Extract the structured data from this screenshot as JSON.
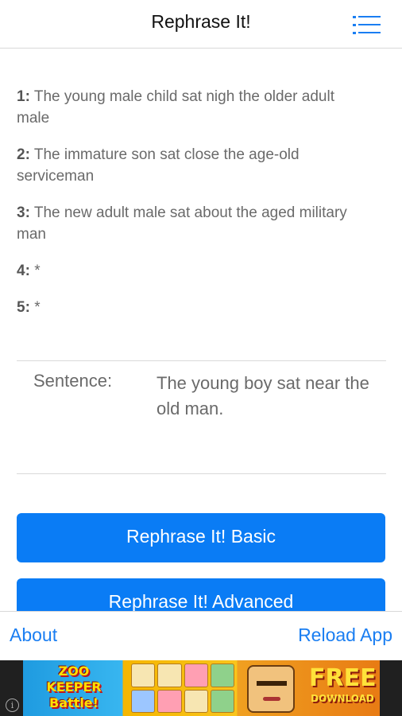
{
  "header": {
    "title": "Rephrase It!",
    "menu_icon": "list-menu-icon"
  },
  "results": [
    {
      "num": "1:",
      "text": "The young male child sat nigh the older adult male"
    },
    {
      "num": "2:",
      "text": "The immature son sat close the age-old serviceman"
    },
    {
      "num": "3:",
      "text": "The new adult male sat about the aged military man"
    },
    {
      "num": "4:",
      "text": "*"
    },
    {
      "num": "5:",
      "text": "*"
    }
  ],
  "sentence": {
    "label": "Sentence:",
    "value": "The young boy sat near the old man."
  },
  "buttons": {
    "basic": "Rephrase It! Basic",
    "advanced": "Rephrase It! Advanced"
  },
  "footer": {
    "about": "About",
    "reload": "Reload App"
  },
  "ad": {
    "info_icon": "info-icon",
    "title_line1": "ZOO",
    "title_line2": "KEEPER",
    "title_line3": "Battle!",
    "cta_line1": "FREE",
    "cta_line2": "DOWNLOAD"
  },
  "colors": {
    "accent": "#0a7cf5",
    "link": "#1a7ef2"
  }
}
